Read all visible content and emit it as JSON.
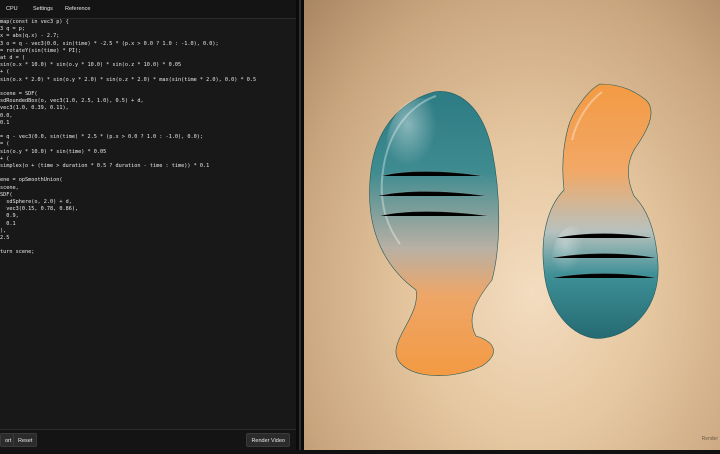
{
  "tabs": {
    "cpu": "CPU",
    "settings": "Settings",
    "reference": "Reference"
  },
  "code": [
    "map(const in vec3 p) {",
    "3 q = p;",
    "x = abs(q.x) - 2.7;",
    "3 o = q - vec3(0.0, sin(time) * -2.5 * (p.x > 0.0 ? 1.0 : -1.0), 0.0);",
    "= rotateY(sin(time) * PI);",
    "at d = (",
    "sin(o.x * 10.0) * sin(o.y * 10.0) * sin(o.z * 10.0) * 0.05",
    "+ (",
    "sin(o.x * 2.0) * sin(o.y * 2.0) * sin(o.z * 2.0) * max(sin(time * 2.0), 0.0) * 0.5",
    "",
    "scene = SDF(",
    "sdRoundedBox(o, vec3(1.0, 2.5, 1.0), 0.5) + d,",
    "vec3(1.0, 0.39, 0.11),",
    "0.0,",
    "0.1",
    "",
    "= q - vec3(0.0, sin(time) * 2.5 * (p.x > 0.0 ? 1.0 : -1.0), 0.0);",
    "= (",
    "sin(o.y * 10.0) * sin(time) * 0.05",
    "+ (",
    "simplex(o + (time > duration * 0.5 ? duration - time : time)) * 0.1",
    "",
    "ene = opSmoothUnion(",
    "scene,",
    "SDF(",
    "  sdSphere(o, 2.0) + d,",
    "  vec3(0.15, 0.78, 0.86),",
    "  0.9,",
    "  0.1",
    "),",
    "2.5",
    "",
    "turn scene;"
  ],
  "buttons": {
    "export": "ort",
    "reset": "Reset",
    "render_video": "Render Video"
  },
  "viewport": {
    "watermark": "Render"
  },
  "colors": {
    "orange": "#f0a04b",
    "teal": "#2f7f86",
    "bg_warm": "#e6c8a1"
  }
}
